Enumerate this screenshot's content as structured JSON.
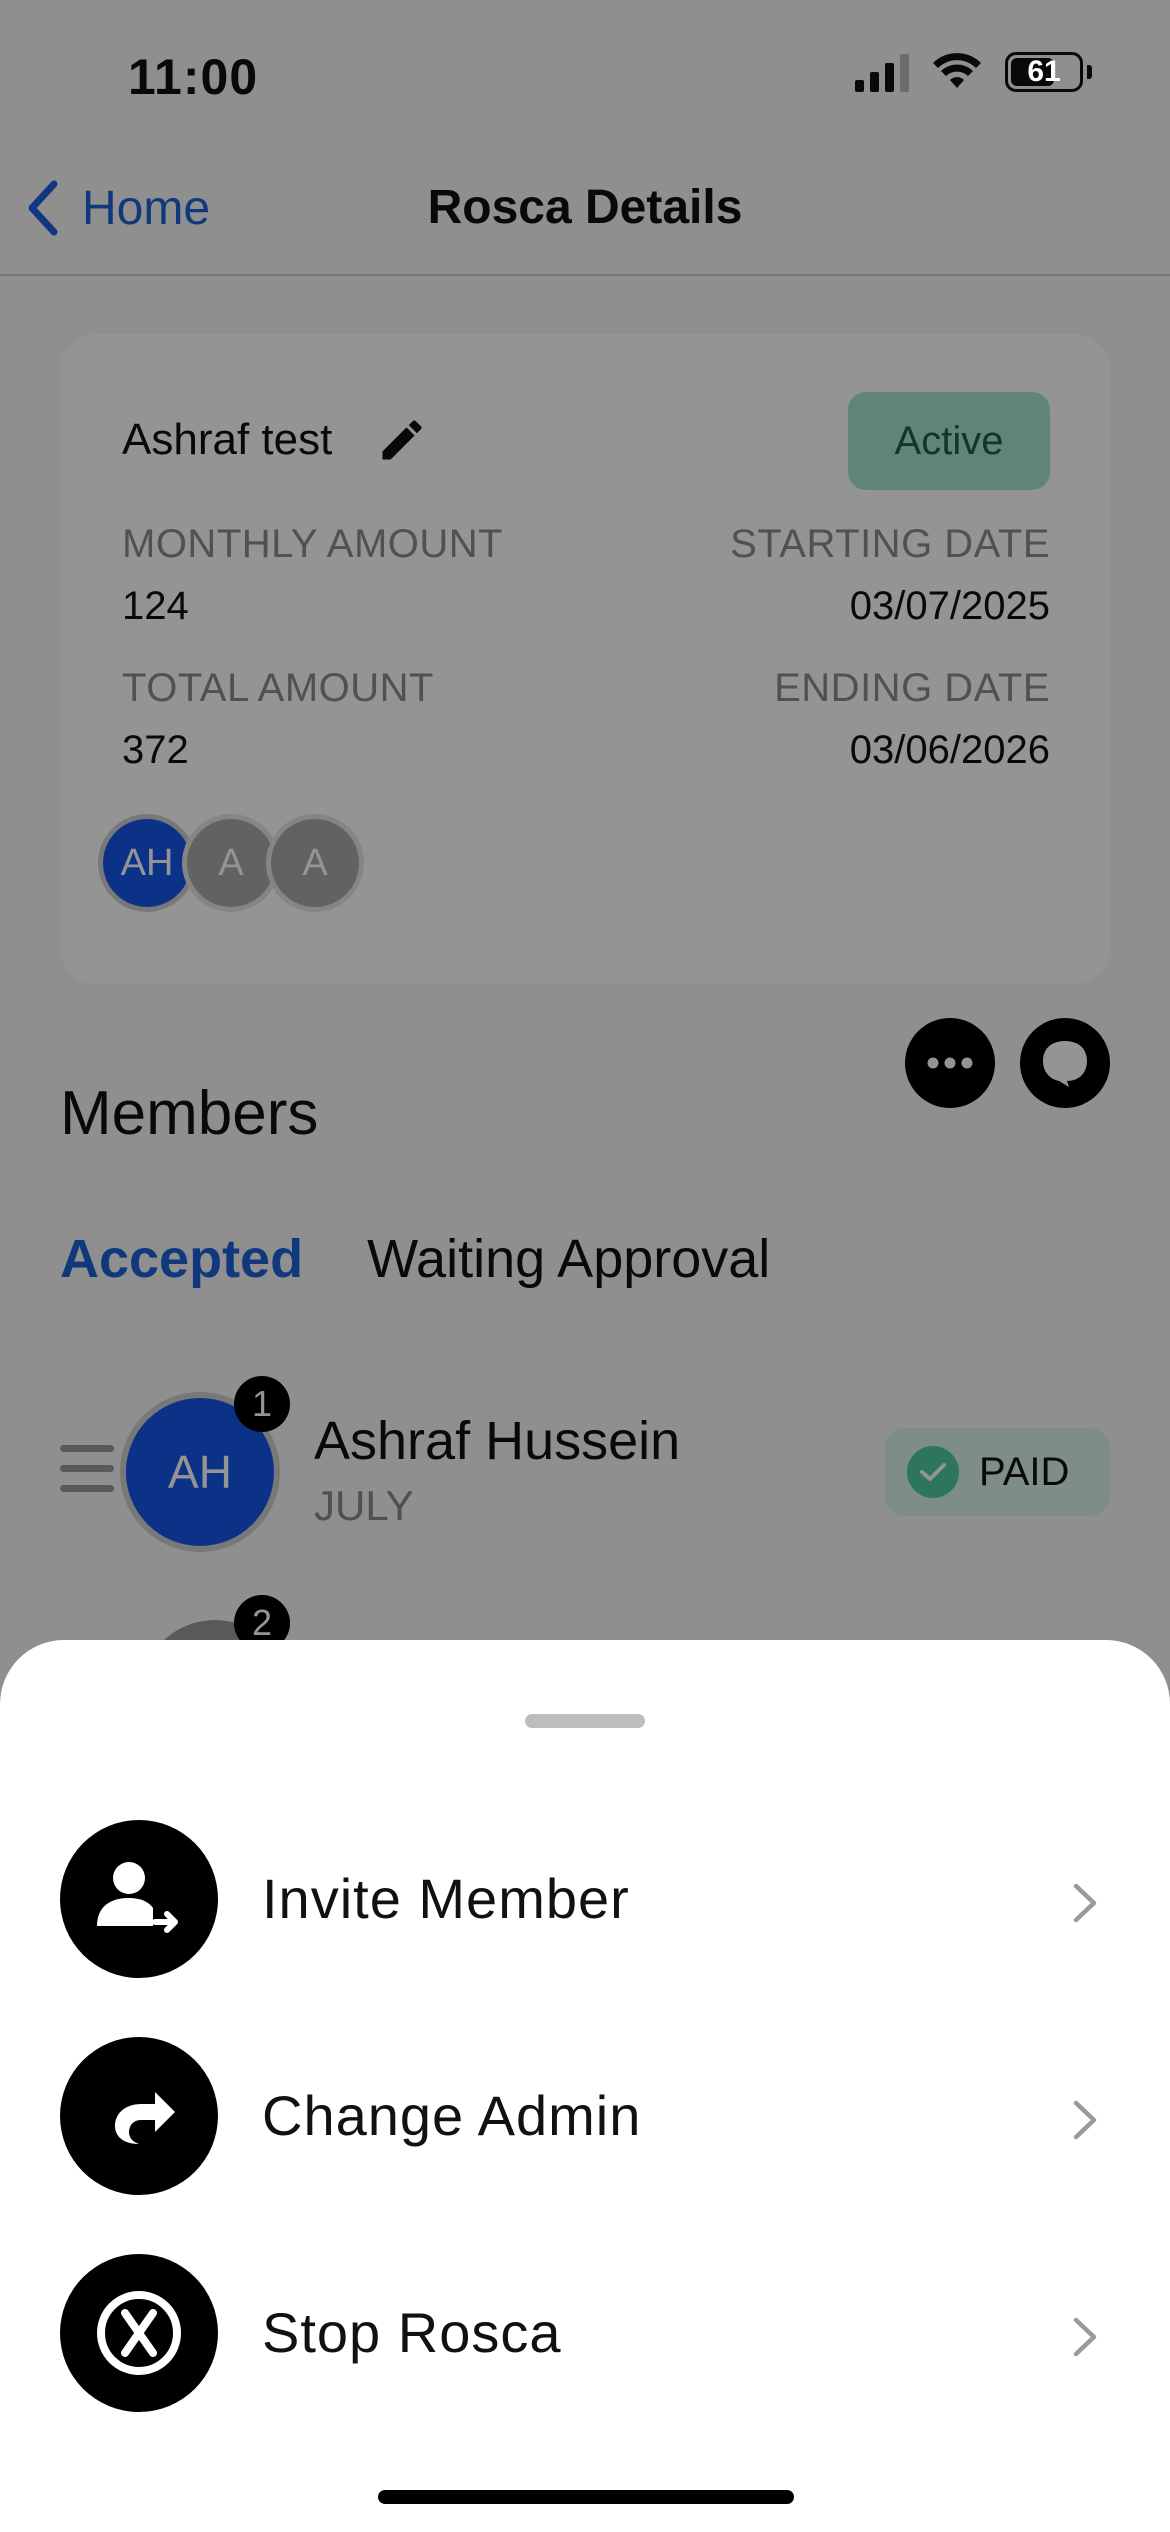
{
  "status_bar": {
    "time": "11:00",
    "battery": "61"
  },
  "nav": {
    "back_label": "Home",
    "title": "Rosca Details"
  },
  "rosca": {
    "name": "Ashraf test",
    "status": "Active",
    "monthly_amount_label": "MONTHLY AMOUNT",
    "monthly_amount": "124",
    "starting_date_label": "STARTING DATE",
    "starting_date": "03/07/2025",
    "total_amount_label": "TOTAL AMOUNT",
    "total_amount": "372",
    "ending_date_label": "ENDING DATE",
    "ending_date": "03/06/2026",
    "avatars": [
      "AH",
      "A",
      "A"
    ]
  },
  "members": {
    "title": "Members",
    "tabs": [
      {
        "label": "Accepted",
        "active": true
      },
      {
        "label": "Waiting Approval",
        "active": false
      }
    ],
    "list": [
      {
        "rank": "1",
        "initials": "AH",
        "name": "Ashraf Hussein",
        "month": "JULY",
        "status": "PAID"
      },
      {
        "rank": "2"
      }
    ]
  },
  "sheet": {
    "actions": [
      {
        "label": "Invite Member",
        "icon": "invite-member-icon"
      },
      {
        "label": "Change Admin",
        "icon": "change-admin-icon"
      },
      {
        "label": "Stop Rosca",
        "icon": "stop-rosca-icon"
      }
    ]
  },
  "colors": {
    "accent": "#1a63d6",
    "avatar_blue": "#1456e8",
    "active_badge_bg": "#a6e6cf",
    "paid_check": "#4ecba0"
  }
}
